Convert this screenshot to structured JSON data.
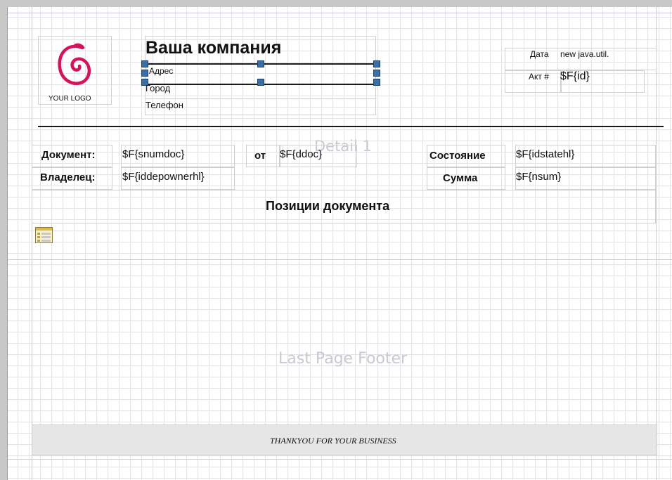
{
  "logo": {
    "caption": "YOUR LOGO",
    "color": "#d4145a"
  },
  "company": {
    "name": "Ваша компания",
    "address": "Адрес",
    "city": "Город",
    "phone": "Телефон"
  },
  "header_right": {
    "date_label": "Дата",
    "date_value": "new java.util.",
    "act_label": "Акт #",
    "act_value": "$F{id}"
  },
  "details": {
    "document_label": "Документ:",
    "document_value": "$F{snumdoc}",
    "from_label": "от",
    "from_value": "$F{ddoc}",
    "state_label": "Состояние",
    "state_value": "$F{idstatehl}",
    "owner_label": "Владелец:",
    "owner_value": "$F{iddepownerhl}",
    "sum_label": "Сумма",
    "sum_value": "$F{nsum}",
    "positions_title": "Позиции документа"
  },
  "bands": {
    "detail": "Detail 1",
    "last_page_footer": "Last Page Footer"
  },
  "footer": {
    "text": "THANKYOU FOR YOUR BUSINESS"
  },
  "icons": {
    "subreport": "table-icon"
  },
  "colors": {
    "handle": "#3b6fa8",
    "footer_bg": "#e6e6e6",
    "band_guides": "#c9c9ee"
  }
}
